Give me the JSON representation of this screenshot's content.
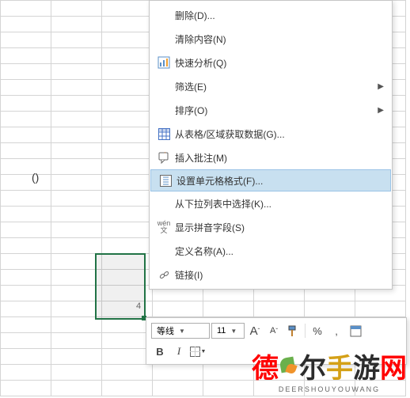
{
  "cell_value": "()",
  "selection_label": "4",
  "menu": {
    "items": [
      {
        "icon": "",
        "label": "删除(D)...",
        "sub": false
      },
      {
        "icon": "",
        "label": "清除内容(N)",
        "sub": false
      },
      {
        "icon": "quick-analysis",
        "label": "快速分析(Q)",
        "sub": false
      },
      {
        "icon": "",
        "label": "筛选(E)",
        "sub": true
      },
      {
        "icon": "",
        "label": "排序(O)",
        "sub": true
      },
      {
        "icon": "table",
        "label": "从表格/区域获取数据(G)...",
        "sub": false
      },
      {
        "icon": "comment",
        "label": "插入批注(M)",
        "sub": false
      },
      {
        "icon": "format-cells",
        "label": "设置单元格格式(F)...",
        "sub": false,
        "hover": true
      },
      {
        "icon": "",
        "label": "从下拉列表中选择(K)...",
        "sub": false
      },
      {
        "icon": "pinyin",
        "label": "显示拼音字段(S)",
        "sub": false
      },
      {
        "icon": "",
        "label": "定义名称(A)...",
        "sub": false
      },
      {
        "icon": "link",
        "label": "链接(I)",
        "sub": false
      }
    ]
  },
  "toolbar": {
    "font_name": "等线",
    "font_size": "11",
    "inc_font": "A",
    "dec_font": "A",
    "percent": "%",
    "comma": ",",
    "bold": "B",
    "italic": "I"
  },
  "watermark": {
    "c1": "德",
    "c2": "尔",
    "c3": "手",
    "c4": "游",
    "c5": "网",
    "domain": "DEERSHOUYOUWANG"
  },
  "colors": {
    "excel_green": "#217346",
    "red": "#ff0000",
    "gold": "#d4a017",
    "dark": "#2c2c2c"
  }
}
